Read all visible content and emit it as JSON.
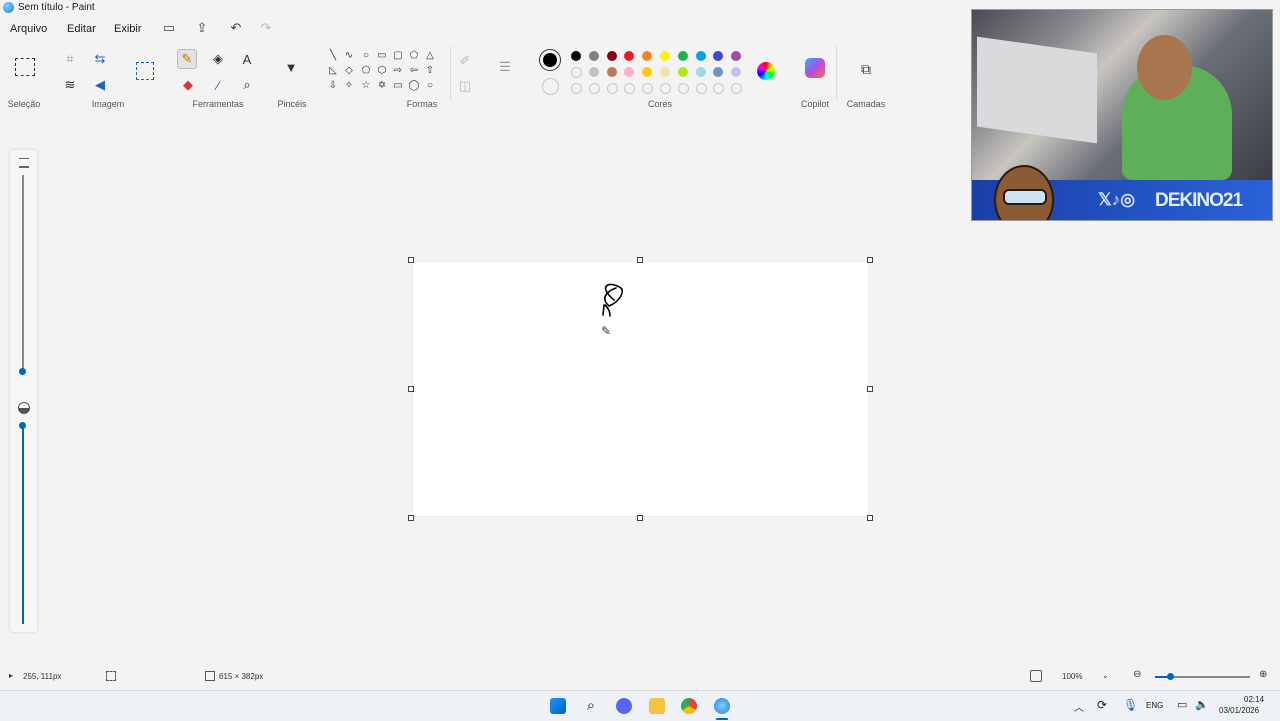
{
  "window": {
    "title": "Sem título - Paint"
  },
  "menu": {
    "file": "Arquivo",
    "edit": "Editar",
    "view": "Exibir"
  },
  "groups": {
    "selection": "Seleção",
    "image": "Imagem",
    "tools": "Ferramentas",
    "brushes": "Pincéis",
    "shapes": "Formas",
    "colors": "Cores",
    "copilot": "Copilot",
    "layers": "Camadas"
  },
  "colors": {
    "row1": [
      "#000000",
      "#7f7f7f",
      "#880015",
      "#ed1c24",
      "#ff7f27",
      "#fff200",
      "#22b14c",
      "#00a2e8",
      "#3f48cc",
      "#a349a4"
    ],
    "row2": [
      "",
      "#c3c3c3",
      "#b97a57",
      "#ffaec9",
      "#ffc90e",
      "#efe4b0",
      "#b5e61d",
      "#99d9ea",
      "#7092be",
      "#c8bfe7"
    ],
    "row3": [
      "",
      "",
      "",
      "",
      "",
      "",
      "",
      "",
      "",
      ""
    ],
    "primary": "#000000",
    "accent": "#0067c0"
  },
  "statusbar": {
    "cursor_pos": "255, 111px",
    "canvas_size": "615 × 382px",
    "zoom": "100%"
  },
  "taskbar": {
    "lang": "ENG",
    "time": "02:14",
    "date": "03/01/2026"
  },
  "webcam": {
    "banner": "DEKINO21"
  }
}
